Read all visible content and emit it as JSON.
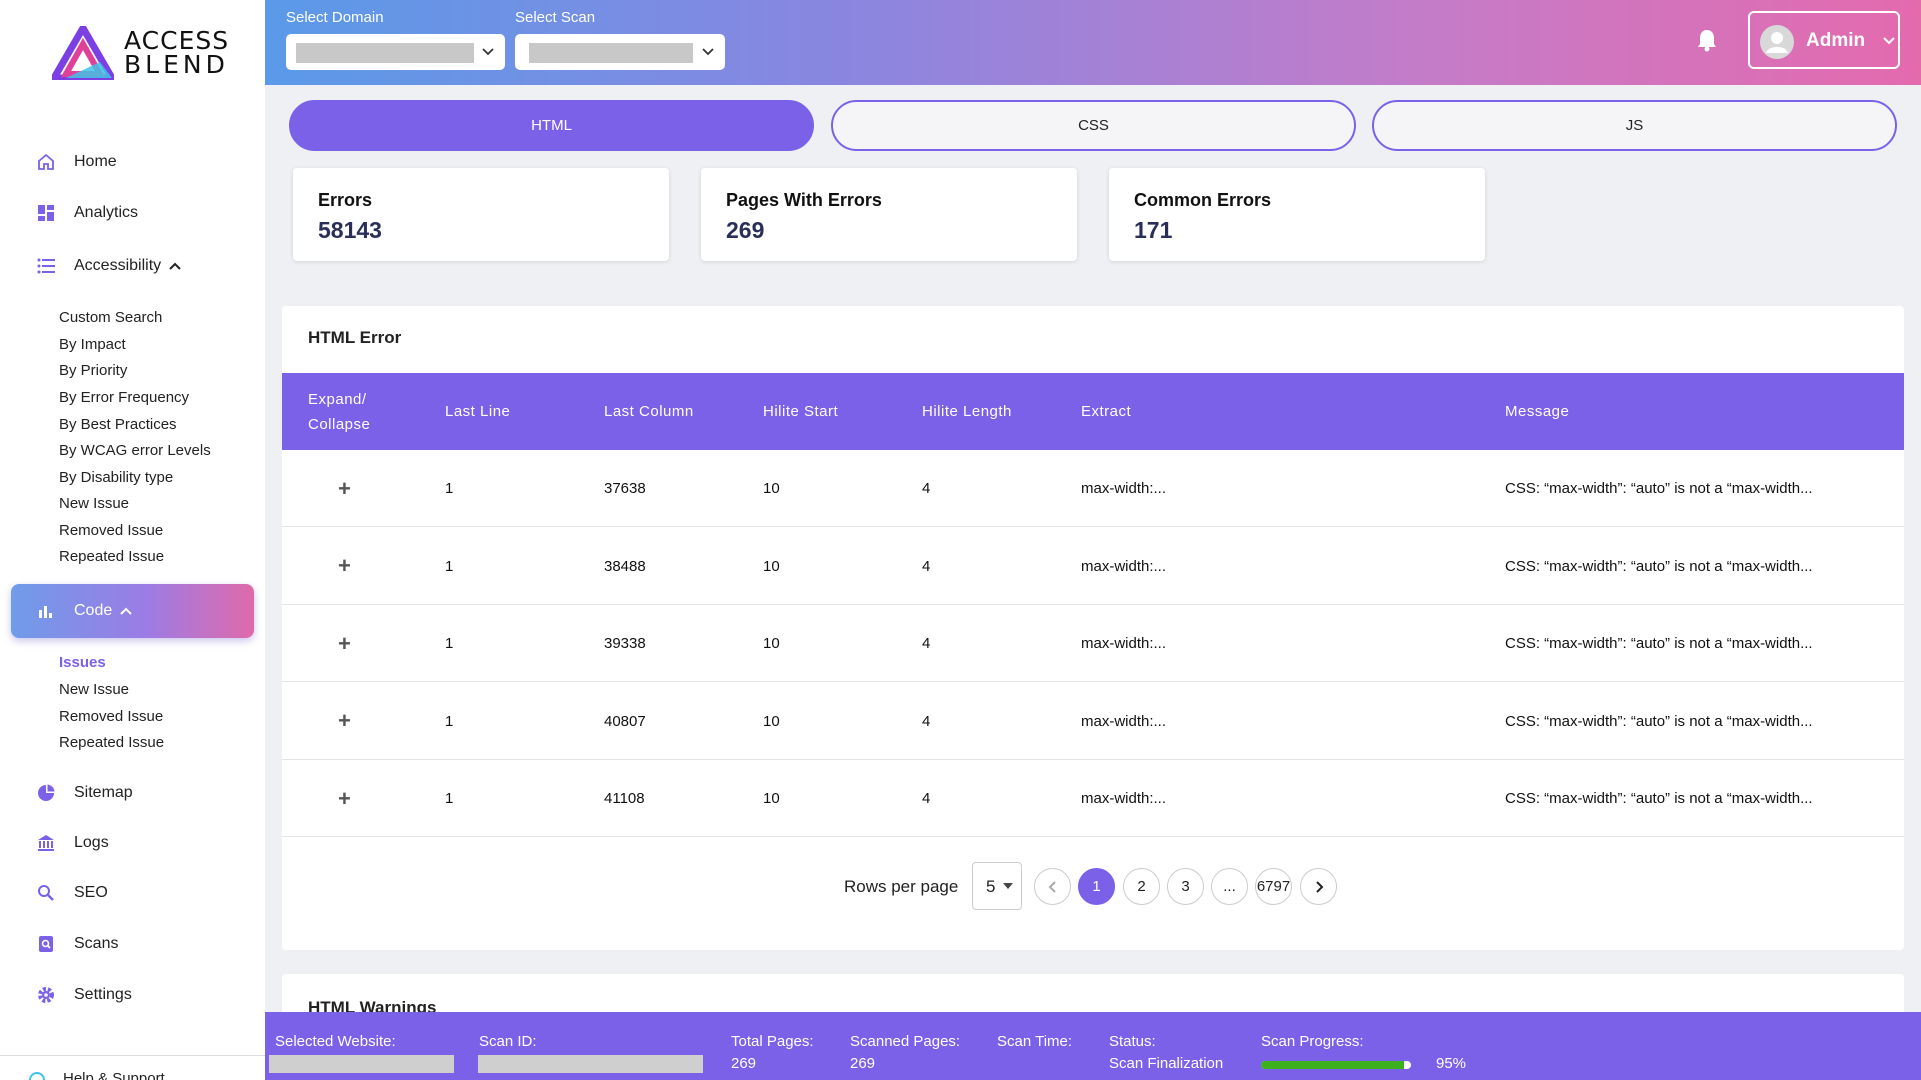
{
  "brand": {
    "line1": "ACCESS",
    "line2": "BLEND"
  },
  "sidebar": {
    "home": "Home",
    "analytics": "Analytics",
    "accessibility": "Accessibility",
    "accessibility_sub": [
      "Custom Search",
      "By Impact",
      "By Priority",
      "By Error Frequency",
      "By Best Practices",
      "By WCAG error Levels",
      "By Disability type",
      "New Issue",
      "Removed Issue",
      "Repeated Issue"
    ],
    "code": "Code",
    "code_sub": [
      "Issues",
      "New Issue",
      "Removed Issue",
      "Repeated Issue"
    ],
    "sitemap": "Sitemap",
    "logs": "Logs",
    "seo": "SEO",
    "scans": "Scans",
    "settings": "Settings",
    "help": "Help & Support"
  },
  "header": {
    "select_domain_label": "Select Domain",
    "select_scan_label": "Select Scan",
    "user_name": "Admin"
  },
  "tabs": [
    "HTML",
    "CSS",
    "JS"
  ],
  "stats": [
    {
      "title": "Errors",
      "value": "58143"
    },
    {
      "title": "Pages With Errors",
      "value": "269"
    },
    {
      "title": "Common Errors",
      "value": "171"
    }
  ],
  "table": {
    "title": "HTML Error",
    "headers": [
      "Expand/ Collapse",
      "Last Line",
      "Last Column",
      "Hilite Start",
      "Hilite Length",
      "Extract",
      "Message"
    ],
    "rows": [
      {
        "expand": "+",
        "last_line": "1",
        "last_column": "37638",
        "hilite_start": "10",
        "hilite_length": "4",
        "extract": "max-width:...",
        "message": "CSS: “max-width”: “auto” is not a “max-width..."
      },
      {
        "expand": "+",
        "last_line": "1",
        "last_column": "38488",
        "hilite_start": "10",
        "hilite_length": "4",
        "extract": "max-width:...",
        "message": "CSS: “max-width”: “auto” is not a “max-width..."
      },
      {
        "expand": "+",
        "last_line": "1",
        "last_column": "39338",
        "hilite_start": "10",
        "hilite_length": "4",
        "extract": "max-width:...",
        "message": "CSS: “max-width”: “auto” is not a “max-width..."
      },
      {
        "expand": "+",
        "last_line": "1",
        "last_column": "40807",
        "hilite_start": "10",
        "hilite_length": "4",
        "extract": "max-width:...",
        "message": "CSS: “max-width”: “auto” is not a “max-width..."
      },
      {
        "expand": "+",
        "last_line": "1",
        "last_column": "41108",
        "hilite_start": "10",
        "hilite_length": "4",
        "extract": "max-width:...",
        "message": "CSS: “max-width”: “auto” is not a “max-width..."
      }
    ]
  },
  "pagination": {
    "rows_per_page_label": "Rows per page",
    "rows_per_page": "5",
    "pages": [
      "1",
      "2",
      "3",
      "...",
      "6797"
    ],
    "current": "1"
  },
  "warnings_title": "HTML Warnings",
  "footer": {
    "selected_website_label": "Selected Website:",
    "scan_id_label": "Scan ID:",
    "total_pages_label": "Total Pages:",
    "total_pages": "269",
    "scanned_pages_label": "Scanned Pages:",
    "scanned_pages": "269",
    "scan_time_label": "Scan Time:",
    "status_label": "Status:",
    "status": "Scan Finalization",
    "scan_progress_label": "Scan Progress:",
    "scan_progress": "95%",
    "scan_progress_fraction": 0.95
  },
  "colors": {
    "accent": "#7b61e8",
    "progress": "#3cb01f"
  }
}
